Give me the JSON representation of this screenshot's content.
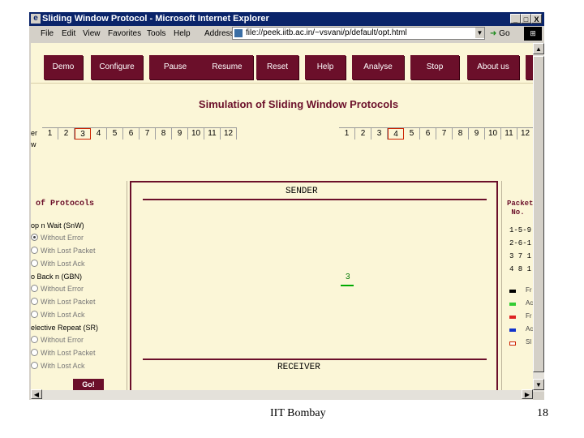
{
  "window": {
    "title": "Sliding Window Protocol - Microsoft Internet Explorer",
    "controls": [
      "_",
      "□",
      "X"
    ]
  },
  "menubar": {
    "items": [
      "File",
      "Edit",
      "View",
      "Favorites",
      "Tools",
      "Help"
    ],
    "address_label": "Address",
    "address_value": "file://peek.iitb.ac.in/~vsvani/p/default/opt.html",
    "go_label": "Go",
    "brand_logo": "windows-logo"
  },
  "nav_buttons": [
    "Demo",
    "Configure",
    "Pause",
    "Resume",
    "Reset",
    "Help",
    "Analyse",
    "Stop",
    "About us"
  ],
  "simulation_title": "Simulation of Sliding Window Protocols",
  "sender_seq": {
    "label": "er",
    "label2": "w",
    "numbers": [
      "1",
      "2",
      "3",
      "4",
      "5",
      "6",
      "7",
      "8",
      "9",
      "10",
      "11",
      "12"
    ],
    "selected": "3"
  },
  "receiver_seq": {
    "numbers": [
      "1",
      "2",
      "3",
      "4",
      "5",
      "6",
      "7",
      "8",
      "9",
      "10",
      "11",
      "12"
    ],
    "selected": "4"
  },
  "protocols": {
    "heading": "of Protocols",
    "groups": [
      {
        "name": "op n Wait (SnW)",
        "options": [
          "Without Error",
          "With Lost Packet",
          "With Lost Ack"
        ],
        "selected": 0
      },
      {
        "name": "o Back n (GBN)",
        "options": [
          "Without Error",
          "With Lost Packet",
          "With Lost Ack"
        ],
        "selected": -1
      },
      {
        "name": "elective Repeat (SR)",
        "options": [
          "Without Error",
          "With Lost Packet",
          "With Lost Ack"
        ],
        "selected": -1
      }
    ],
    "go_label": "Go!"
  },
  "sim": {
    "sender_label": "SENDER",
    "receiver_label": "RECEIVER",
    "packet_number": "3"
  },
  "right_panel": {
    "heading": "Packet\n No.",
    "seq_rows": [
      "1-5-9",
      "2-6-1",
      "3 7 1",
      "4 8 1"
    ],
    "legend": [
      {
        "color": "#000000",
        "label": "Fr"
      },
      {
        "color": "#33cc33",
        "label": "Ac"
      },
      {
        "color": "#dd2222",
        "label": "Fr"
      },
      {
        "color": "#1133cc",
        "label": "Ac"
      },
      {
        "color": "#ffffff",
        "label": "Sl"
      }
    ]
  },
  "footer": {
    "text": "IIT Bombay",
    "slide_number": "18"
  }
}
